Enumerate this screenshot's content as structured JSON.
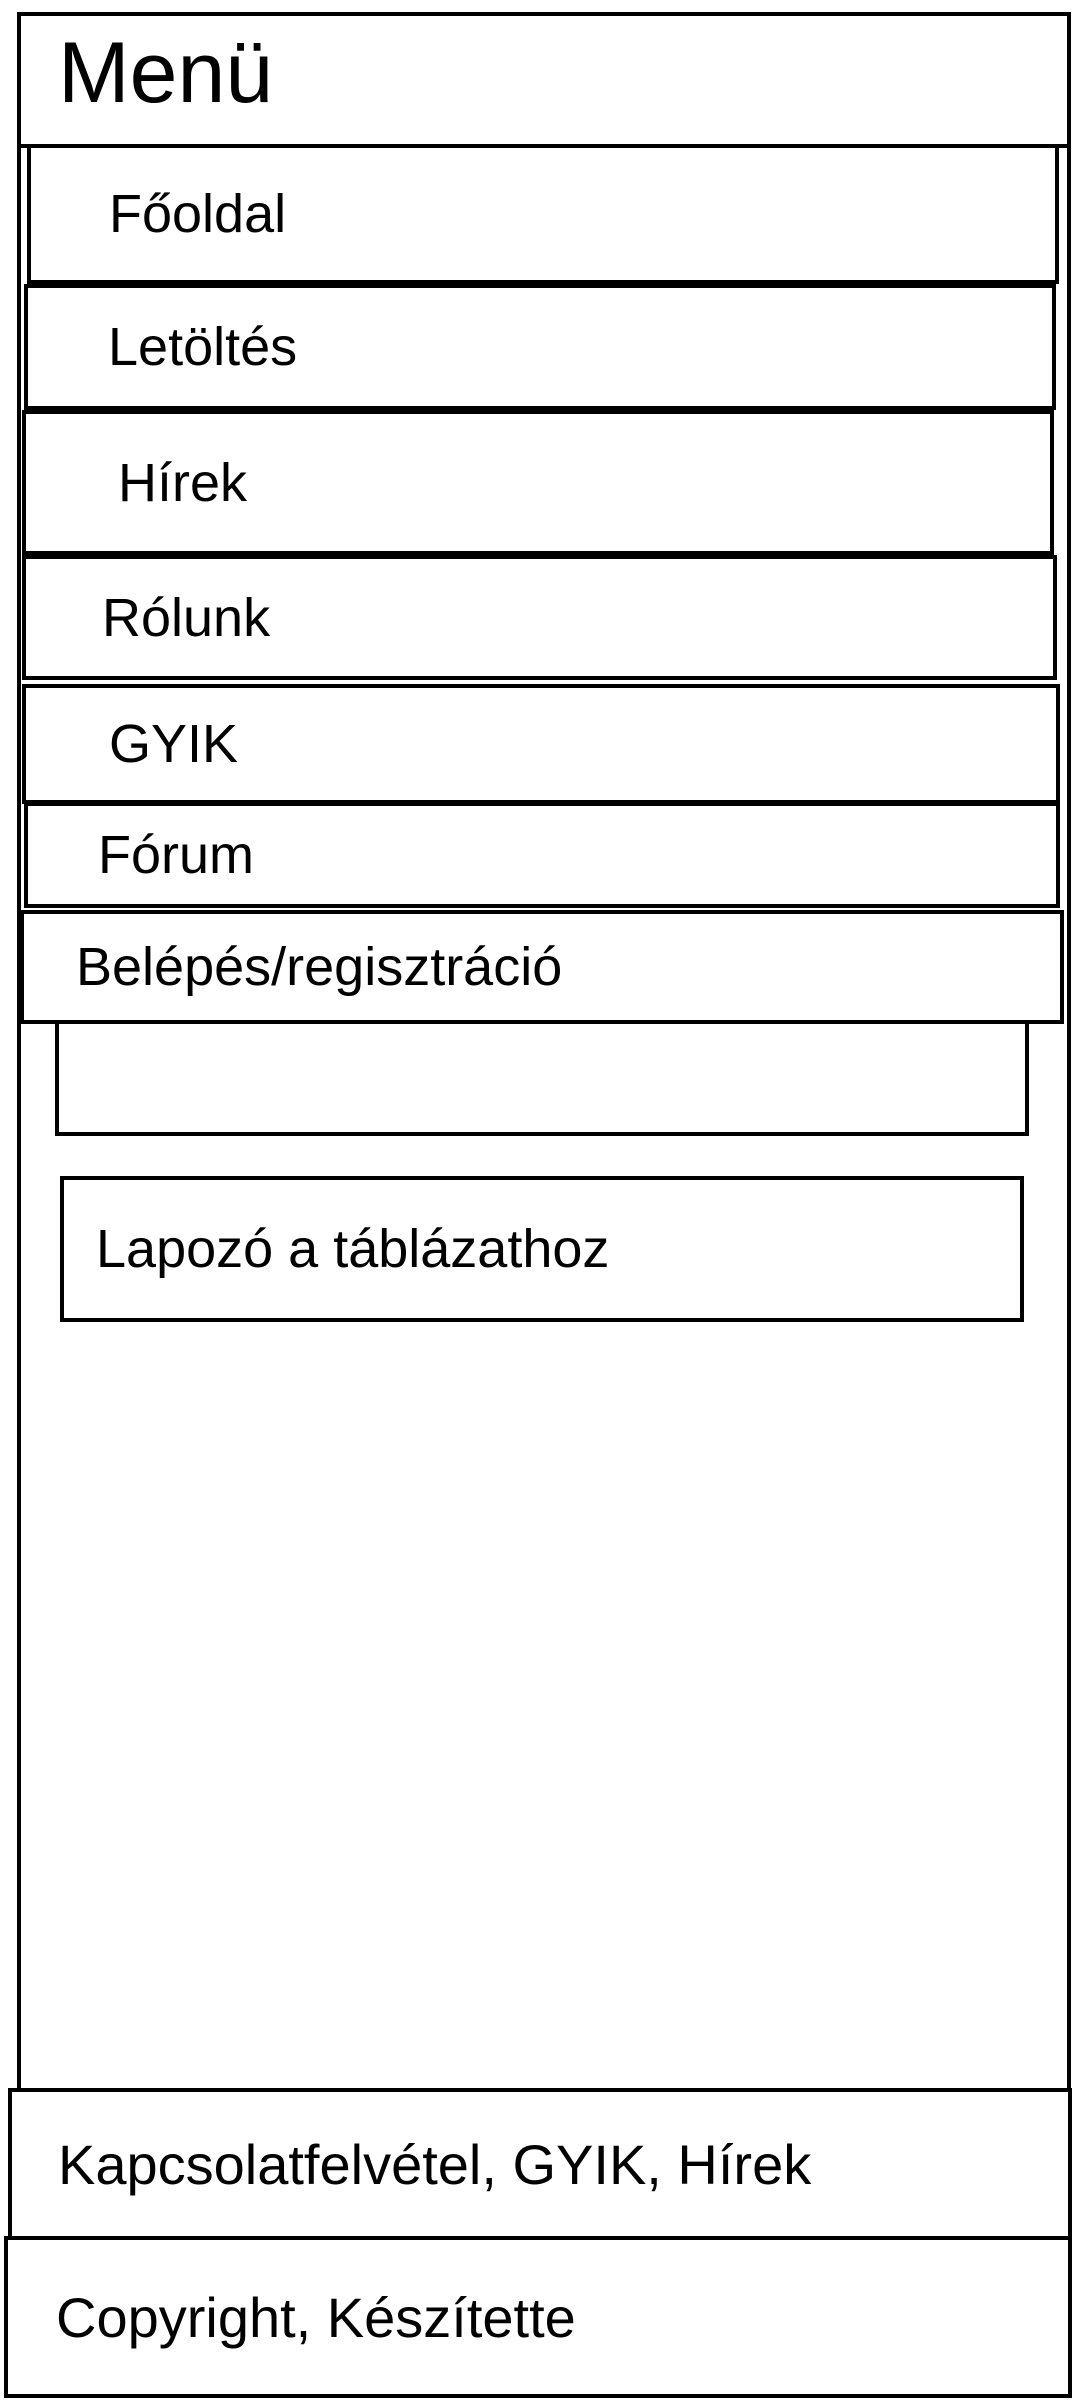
{
  "menu": {
    "title": "Menü",
    "items": [
      {
        "label": "Főoldal"
      },
      {
        "label": "Letöltés"
      },
      {
        "label": "Hírek"
      },
      {
        "label": "Rólunk"
      },
      {
        "label": "GYIK"
      },
      {
        "label": "Fórum"
      },
      {
        "label": "Belépés/regisztráció"
      }
    ]
  },
  "main": {
    "pager_label": "Lapozó a táblázathoz"
  },
  "footer": {
    "links_text": "Kapcsolatfelvétel, GYIK, Hírek",
    "copyright_text": "Copyright, Készítette"
  }
}
